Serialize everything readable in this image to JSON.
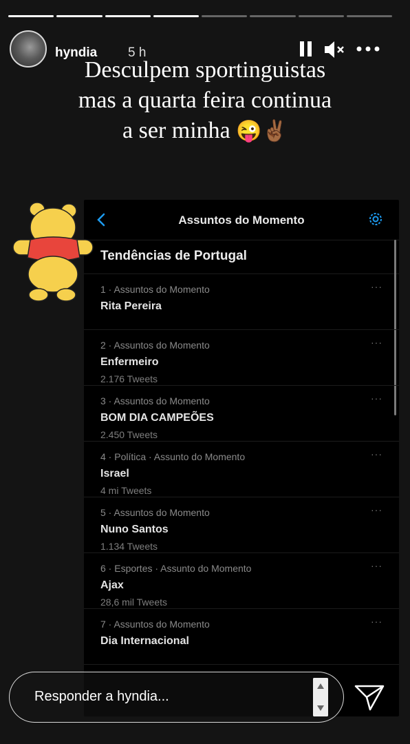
{
  "progress": {
    "total": 8,
    "done": 4
  },
  "header": {
    "username": "hyndia",
    "time": "5 h",
    "icons": [
      "pause-icon",
      "mute-icon",
      "more-icon"
    ]
  },
  "caption": {
    "line1": "Desculpem sportinguistas",
    "line2": "mas a quarta feira continua",
    "line3": "a ser minha",
    "emojis": "😜✌🏾"
  },
  "screenshot": {
    "title": "Assuntos do Momento",
    "heading": "Tendências de Portugal",
    "more_label": "···",
    "trends": [
      {
        "meta": "1 · Assuntos do Momento",
        "name": "Rita Pereira",
        "count": ""
      },
      {
        "meta": "2 · Assuntos do Momento",
        "name": "Enfermeiro",
        "count": "2.176 Tweets"
      },
      {
        "meta": "3 · Assuntos do Momento",
        "name": "BOM DIA CAMPEÕES",
        "count": "2.450 Tweets"
      },
      {
        "meta": "4 · Política · Assunto do Momento",
        "name": "Israel",
        "count": "4 mi Tweets"
      },
      {
        "meta": "5 · Assuntos do Momento",
        "name": "Nuno Santos",
        "count": "1.134 Tweets"
      },
      {
        "meta": "6 · Esportes · Assunto do Momento",
        "name": "Ajax",
        "count": "28,6 mil Tweets"
      },
      {
        "meta": "7 · Assuntos do Momento",
        "name": "Dia Internacional",
        "count": ""
      }
    ]
  },
  "reply": {
    "placeholder": "Responder a hyndia..."
  },
  "colors": {
    "background": "#141414",
    "accent": "#1d9bf0",
    "sticker_yellow": "#f6d04d",
    "sticker_red": "#e8453c"
  }
}
